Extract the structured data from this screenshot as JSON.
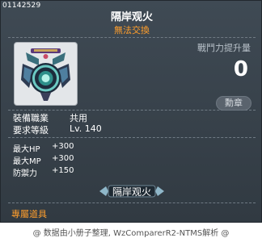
{
  "item": {
    "id": "01142529",
    "name": "隔岸观火",
    "trade_status": "無法交換"
  },
  "power": {
    "label": "戰鬥力提升量",
    "value": "0",
    "medal_button": "勳章"
  },
  "requirements": [
    {
      "label": "裝備職業",
      "value": "共用"
    },
    {
      "label": "要求等級",
      "value": "Lv. 140"
    }
  ],
  "stats": [
    {
      "label": "最大HP",
      "value": "+300"
    },
    {
      "label": "最大MP",
      "value": "+300"
    },
    {
      "label": "防禦力",
      "value": "+150"
    }
  ],
  "set_button": "隔岸观火",
  "exclusive_label": "專屬道具",
  "footer": "@ 数据由小册子整理, WzComparerR2-NTMS解析 @",
  "colors": {
    "background": "#313a42",
    "accent_orange": "#ff9e2c",
    "text": "#ffffff"
  },
  "icons": [
    "medal-item-icon",
    "wing-left-icon",
    "wing-right-icon"
  ]
}
